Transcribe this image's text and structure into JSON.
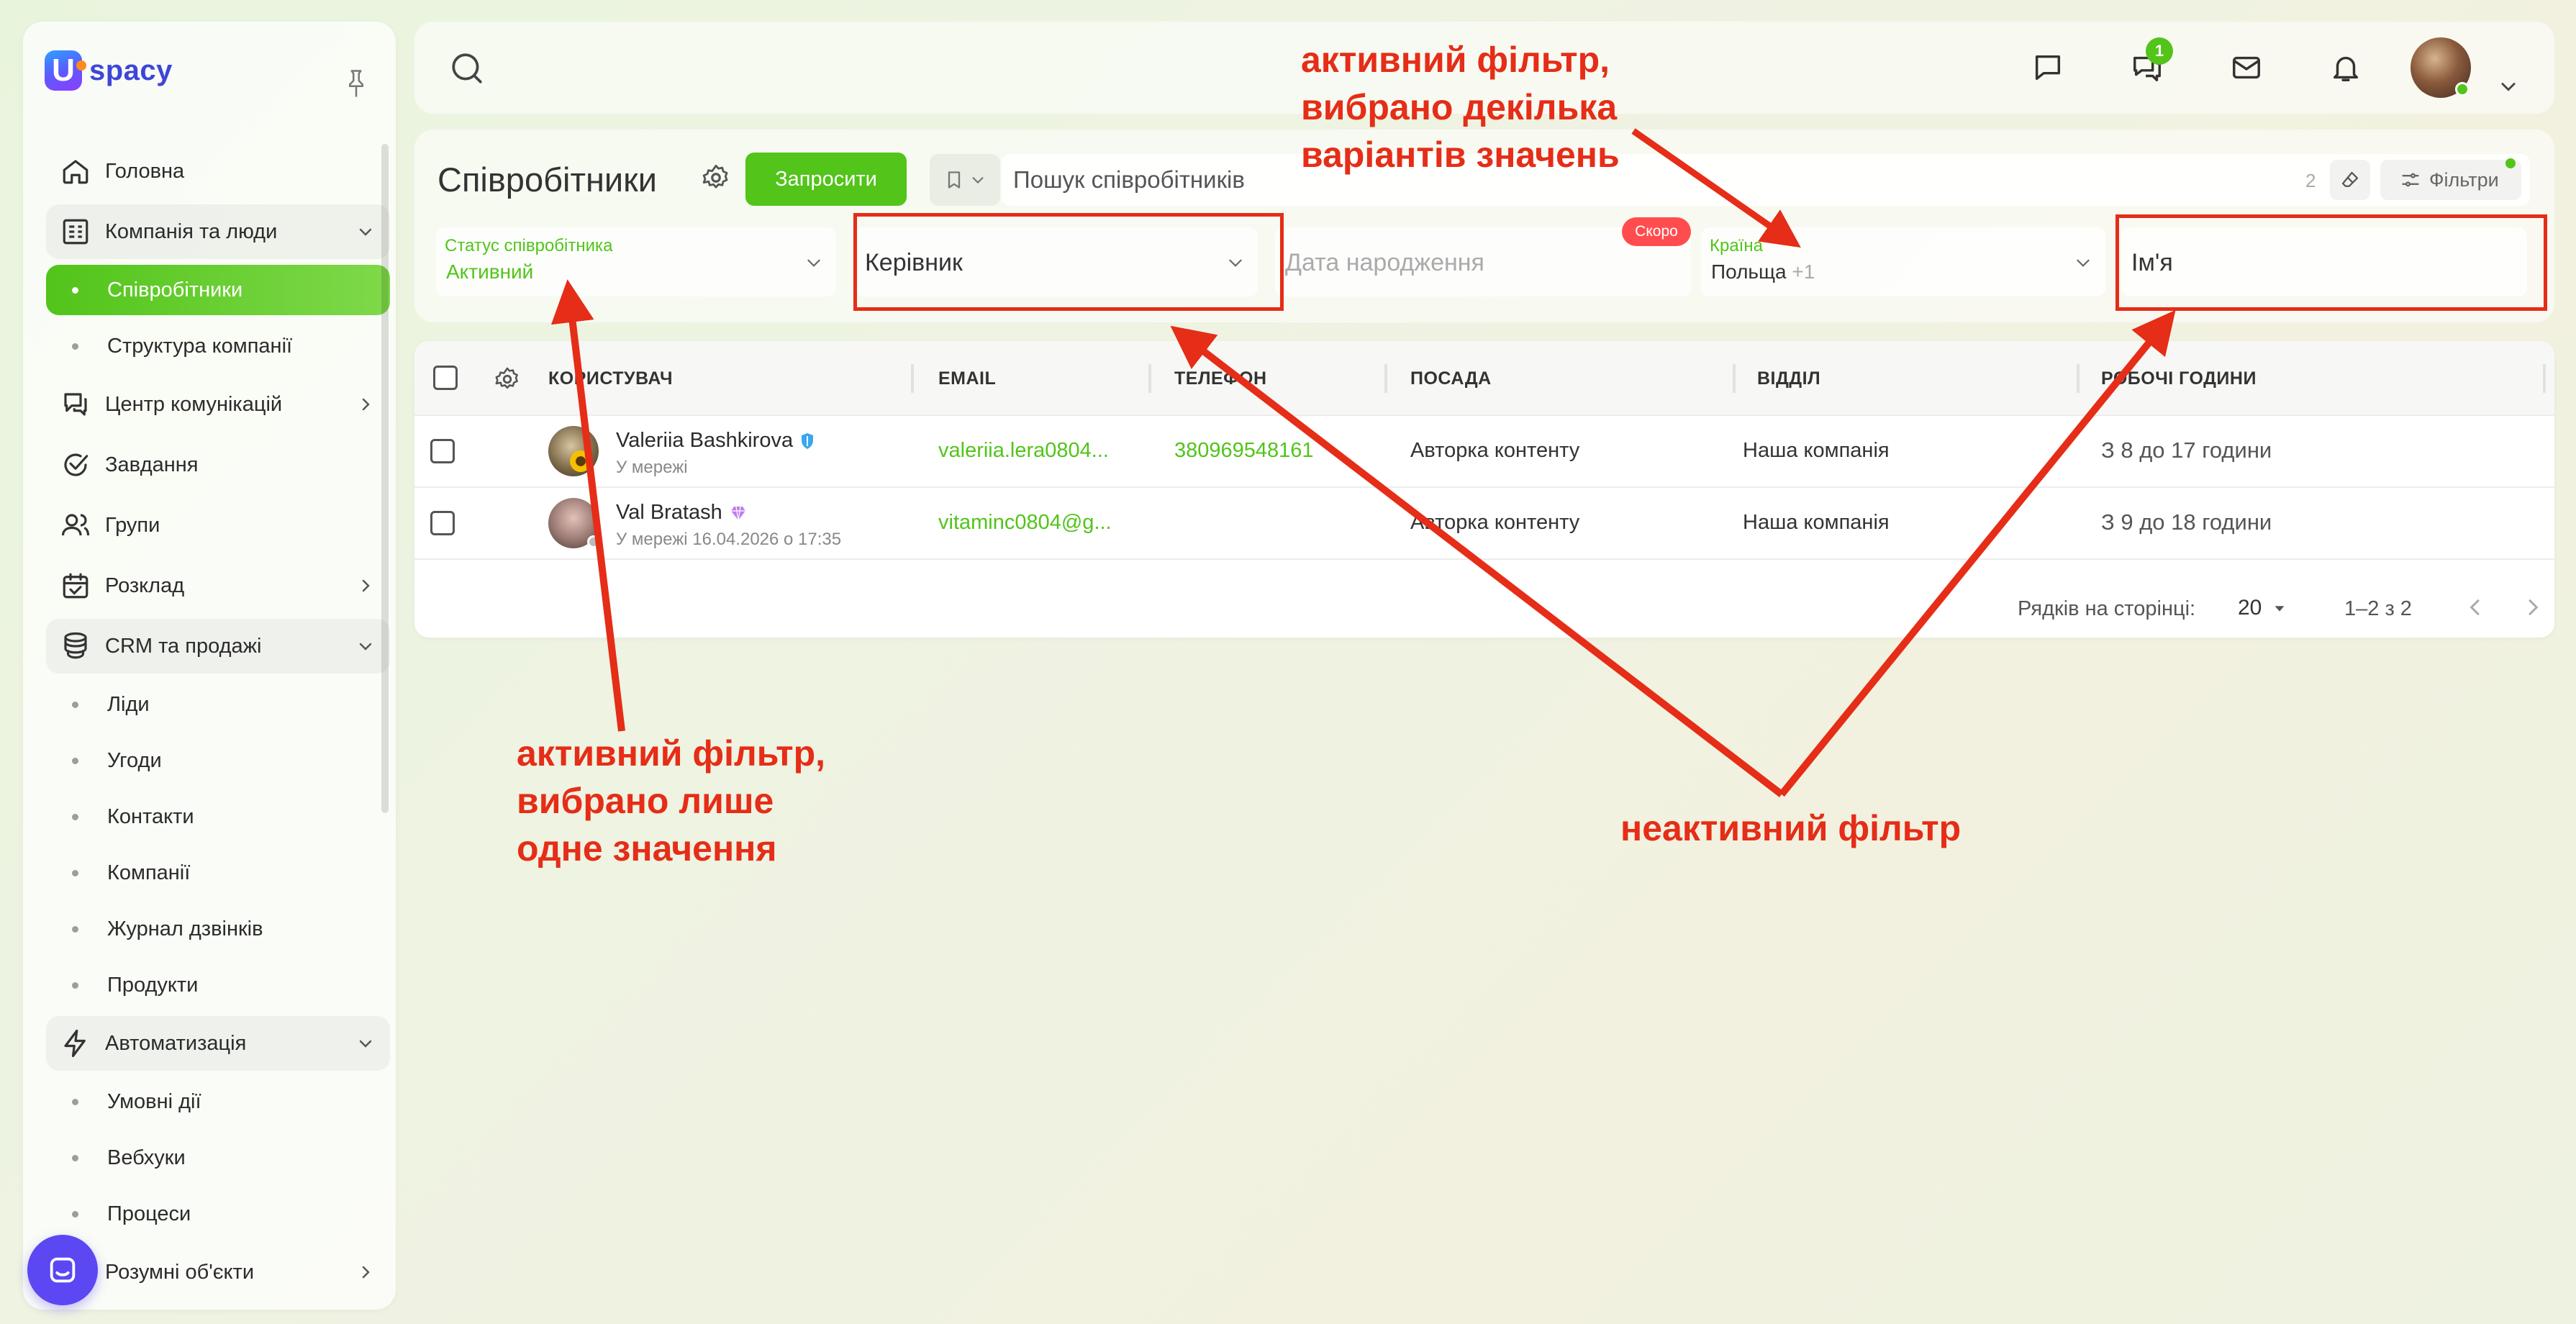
{
  "app": {
    "logo_text": "spacy",
    "logo_letter": "U"
  },
  "sidebar": {
    "items": [
      {
        "type": "item",
        "label": "Головна",
        "icon": "home-icon"
      },
      {
        "type": "group",
        "label": "Компанія та люди",
        "icon": "building-icon",
        "expanded": true
      },
      {
        "type": "sub",
        "label": "Співробітники",
        "active": true
      },
      {
        "type": "sub",
        "label": "Структура компанії"
      },
      {
        "type": "item",
        "label": "Центр комунікацій",
        "icon": "communication-icon",
        "chevron": "right"
      },
      {
        "type": "item",
        "label": "Завдання",
        "icon": "check-circle-icon"
      },
      {
        "type": "item",
        "label": "Групи",
        "icon": "users-icon"
      },
      {
        "type": "item",
        "label": "Розклад",
        "icon": "calendar-icon",
        "chevron": "right"
      },
      {
        "type": "group",
        "label": "CRM та продажі",
        "icon": "database-icon",
        "expanded": true
      },
      {
        "type": "sub",
        "label": "Ліди"
      },
      {
        "type": "sub",
        "label": "Угоди"
      },
      {
        "type": "sub",
        "label": "Контакти"
      },
      {
        "type": "sub",
        "label": "Компанії"
      },
      {
        "type": "sub",
        "label": "Журнал дзвінків"
      },
      {
        "type": "sub",
        "label": "Продукти"
      },
      {
        "type": "group",
        "label": "Автоматизація",
        "icon": "lightning-icon",
        "expanded": true
      },
      {
        "type": "sub",
        "label": "Умовні дії"
      },
      {
        "type": "sub",
        "label": "Вебхуки"
      },
      {
        "type": "sub",
        "label": "Процеси"
      },
      {
        "type": "item",
        "label": "Розумні об'єкти",
        "icon": "cube-icon",
        "chevron": "right"
      }
    ]
  },
  "topbar": {
    "chat_badge": "1"
  },
  "page": {
    "title": "Співробітники",
    "invite_label": "Запросити",
    "search_placeholder": "Пошук співробітників",
    "search_count": "2",
    "filters_label": "Фільтри"
  },
  "filters": {
    "status": {
      "label": "Статус співробітника",
      "value": "Активний"
    },
    "manager": {
      "placeholder": "Керівник"
    },
    "birthday": {
      "placeholder": "Дата народження",
      "badge": "Скоро"
    },
    "country": {
      "label": "Країна",
      "value": "Польща",
      "more": "+1"
    },
    "name": {
      "placeholder": "Ім'я"
    }
  },
  "table": {
    "columns": [
      "КОРИСТУВАЧ",
      "EMAIL",
      "ТЕЛЕФОН",
      "ПОСАДА",
      "ВІДДІЛ",
      "РОБОЧІ ГОДИНИ"
    ],
    "rows": [
      {
        "name": "Valeriia Bashkirova",
        "status": "У мережі",
        "email": "valeriia.lera0804...",
        "phone": "380969548161",
        "position": "Авторка контенту",
        "department": "Наша компанія",
        "hours": "З 8 до 17 години"
      },
      {
        "name": "Val Bratash",
        "status": "У мережі 16.04.2026 о 17:35",
        "email": "vitaminc0804@g...",
        "phone": "",
        "position": "Авторка контенту",
        "department": "Наша компанія",
        "hours": "З 9 до 18 години"
      }
    ],
    "pagination": {
      "rows_label": "Рядків на сторінці:",
      "rows_per_page": "20",
      "range": "1–2 з 2"
    }
  },
  "annotations": {
    "top": [
      "активний фільтр,",
      "вибрано декілька",
      "варіантів значень"
    ],
    "left": [
      "активний фільтр,",
      "вибрано лише",
      "одне значення"
    ],
    "right": "неактивний фільтр"
  },
  "colors": {
    "accent": "#52c41a",
    "annotation": "#e52d17",
    "chat_fab": "#5b48f2"
  }
}
